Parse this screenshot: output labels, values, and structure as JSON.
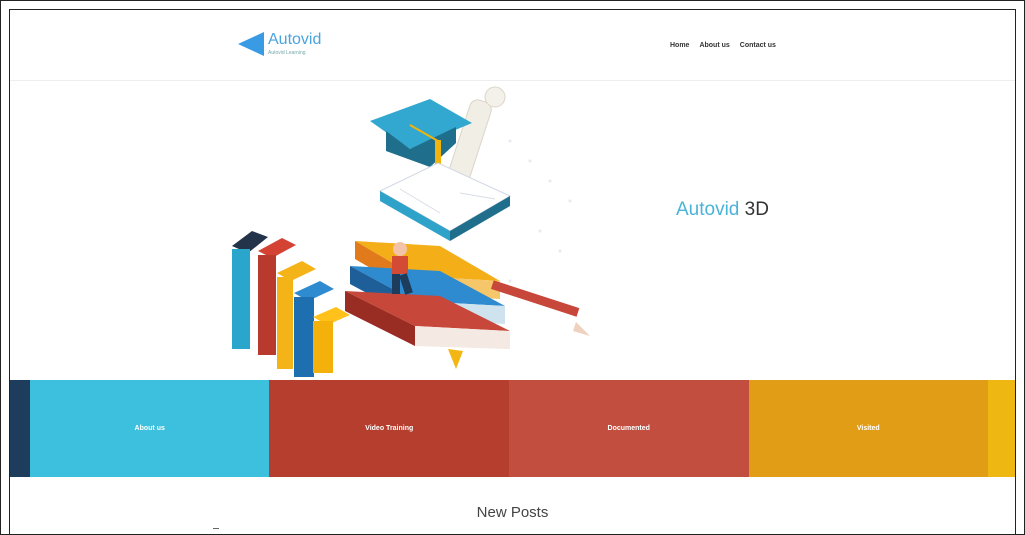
{
  "logo": {
    "name": "Autovid",
    "tagline": "Autovid Learning"
  },
  "nav": {
    "items": [
      "Home",
      "About us",
      "Contact us"
    ]
  },
  "hero": {
    "title_part1": "Autovid",
    "title_part2": "3D"
  },
  "tiles": [
    {
      "label": "",
      "color": "#1e3d5c"
    },
    {
      "label": "About us",
      "color": "#3cc0dd"
    },
    {
      "label": "Video Training",
      "color": "#b53e2f"
    },
    {
      "label": "Documented",
      "color": "#c24e3f"
    },
    {
      "label": "Visited",
      "color": "#e29d17"
    },
    {
      "label": "",
      "color": "#efb712"
    }
  ],
  "section": {
    "title": "New Posts"
  }
}
